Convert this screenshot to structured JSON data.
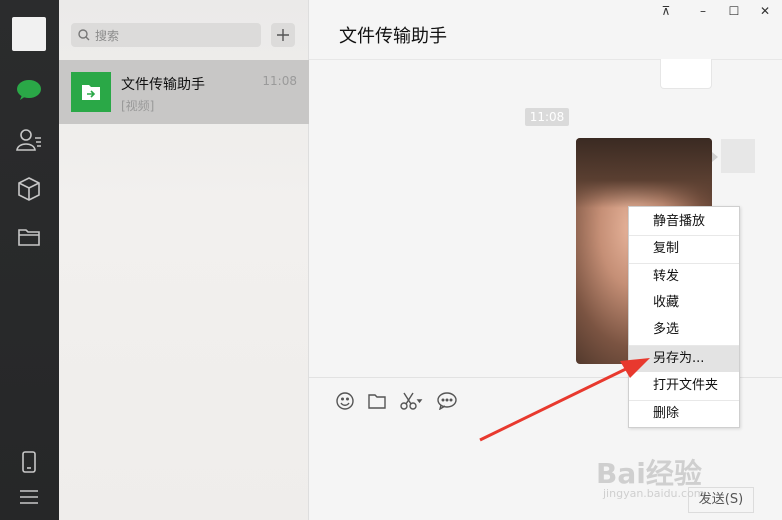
{
  "sidebar": {
    "icons": [
      "chat-icon",
      "contacts-icon",
      "favorites-icon",
      "files-icon",
      "phone-icon",
      "menu-icon"
    ]
  },
  "conversations": {
    "search_placeholder": "搜索",
    "add_label": "+",
    "items": [
      {
        "name": "文件传输助手",
        "time": "11:08",
        "preview": "[视频]"
      }
    ]
  },
  "chat": {
    "title": "文件传输助手",
    "window_controls": [
      "⊼",
      "–",
      "☐",
      "✕"
    ],
    "time_tag": "11:08",
    "send_label": "发送(S)"
  },
  "context_menu": {
    "items": [
      {
        "label": "静音播放"
      },
      {
        "label": "复制"
      },
      {
        "label": "转发"
      },
      {
        "label": "收藏"
      },
      {
        "label": "多选"
      },
      {
        "label": "另存为..."
      },
      {
        "label": "打开文件夹"
      },
      {
        "label": "删除"
      }
    ],
    "highlighted": "另存为..."
  },
  "watermark": {
    "text": "Bai经验",
    "sub": "jingyan.baidu.com"
  },
  "colors": {
    "accent": "#2aa847",
    "arrow": "#e8392e",
    "rail": "#2b2c2d"
  }
}
